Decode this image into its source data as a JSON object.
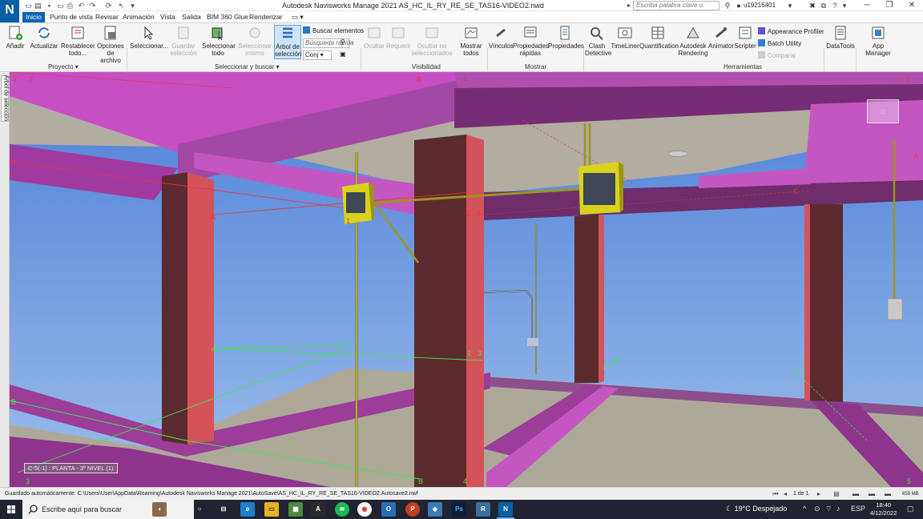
{
  "window": {
    "title": "Autodesk Navisworks Manage 2021    AS_HC_IL_RY_RE_SE_TAS16-VIDEO2.nwd",
    "search_placeholder": "Escriba palabra clave o frase",
    "user": "u19216401",
    "app_letter": "N"
  },
  "menu": {
    "tabs": [
      "Inicio",
      "Punto de vista",
      "Revisar",
      "Animación",
      "Vista",
      "Salida",
      "BIM 360 Glue",
      "Renderizar"
    ],
    "active": "Inicio"
  },
  "ribbon": {
    "proyecto": {
      "label": "Proyecto",
      "buttons": [
        "Añadir",
        "Actualizar",
        "Restablecer todo...",
        "Opciones de archivo"
      ]
    },
    "seleccionar": {
      "label": "Seleccionar y buscar",
      "seleccionar": "Seleccionar...",
      "guardar": "Guardar selección",
      "seleccionar_todo": "Seleccionar todo",
      "seleccionar_mismo": "Seleccionar mismo",
      "arbol": "Árbol de selección",
      "buscar": "Buscar elementos",
      "busqueda_rapida": "Búsqueda rápida",
      "conj": "Conj"
    },
    "visibilidad": {
      "label": "Visibilidad",
      "ocultar": "Ocultar",
      "requerir": "Requerir",
      "ocultar_no_sel": "Ocultar no seleccionados",
      "mostrar_todos": "Mostrar todos"
    },
    "mostrar": {
      "label": "Mostrar",
      "vinculos": "Vínculos",
      "prop_rapidas": "Propiedades rápidas",
      "propiedades": "Propiedades"
    },
    "herramientas": {
      "label": "Herramientas",
      "clash": "Clash Detective",
      "timeliner": "TimeLiner",
      "quantification": "Quantification",
      "rendering": "Autodesk Rendering",
      "animator": "Animator",
      "scripter": "Scripter",
      "appearance": "Appearance Profiler",
      "batch": "Batch Utility",
      "comparar": "Comparar"
    },
    "datatools": "DataTools",
    "appmanager": "App Manager"
  },
  "side_panel": {
    "label": "Árbol de selección"
  },
  "viewport": {
    "level_label": "C-5(-1) : PLANTA - 3º NIVEL (1)",
    "grid_labels": {
      "top_2": "2",
      "top_3": "3",
      "top_B": "B",
      "top_4": "4",
      "top_5": "5",
      "left_B": "B",
      "mid_A": "A",
      "mid_1": "1",
      "mid_2": "2",
      "mid_3": "3",
      "right_A": "A",
      "right_C": "C",
      "gA": "A",
      "g1": "1",
      "g2": "2",
      "g3": "3",
      "gB": "B",
      "g4": "4",
      "g5": "5",
      "bot_B": "B",
      "bot_4": "4",
      "bot_3": "3",
      "bot_5": "5"
    }
  },
  "status": {
    "text": "Guardado automáticamente: C:\\Users\\User\\AppData\\Roaming\\Autodesk Navisworks Manage 2021\\AutoSave\\AS_HC_IL_RY_RE_SE_TAS16-VIDEO2.Autosave2.nwf",
    "page": "1 de 1",
    "memory": "659 MB"
  },
  "taskbar": {
    "search_placeholder": "Escribe aquí para buscar",
    "weather": "19°C  Despejado",
    "lang": "ESP",
    "time": "18:40",
    "date": "4/12/2022"
  },
  "colors": {
    "beam": "#c24fc0",
    "column": "#5b2a2e",
    "column_face": "#d4535a",
    "sky": "#5f8fdb",
    "floor": "#aea899",
    "box": "#d8d21a",
    "accent": "#0a63b2"
  }
}
